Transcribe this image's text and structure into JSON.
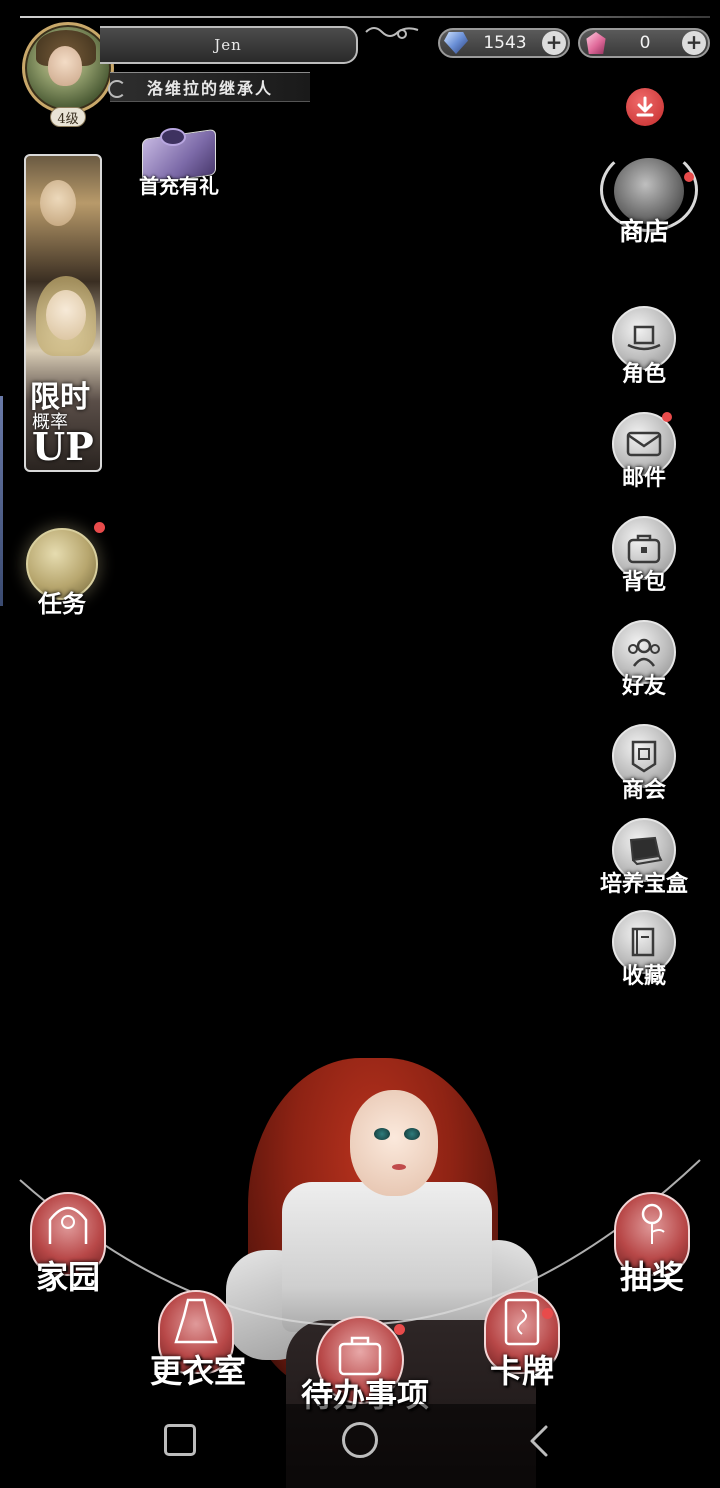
{
  "player": {
    "name": "Jen",
    "title": "洛维拉的继承人",
    "level": "4级"
  },
  "currency": [
    {
      "icon": "blue-crystal-icon",
      "value": "1543"
    },
    {
      "icon": "pink-crystal-icon",
      "value": "0"
    }
  ],
  "promo": {
    "first_recharge_label": "首充有礼",
    "limited_title": "限时",
    "limited_sub": "概率",
    "limited_up": "UP"
  },
  "quest": {
    "label": "任务"
  },
  "shop": {
    "label": "商店"
  },
  "side_menu": [
    {
      "label": "角色",
      "icon": "top-hat-icon",
      "notify": false
    },
    {
      "label": "邮件",
      "icon": "envelope-icon",
      "notify": true
    },
    {
      "label": "背包",
      "icon": "bag-icon",
      "notify": false
    },
    {
      "label": "好友",
      "icon": "friends-icon",
      "notify": false
    },
    {
      "label": "商会",
      "icon": "banner-icon",
      "notify": false
    },
    {
      "label": "培养宝盒",
      "icon": "treasure-box-icon",
      "notify": false
    },
    {
      "label": "收藏",
      "icon": "book-icon",
      "notify": false
    }
  ],
  "bottom_nav": {
    "home": "家园",
    "wardrobe": "更衣室",
    "todo": "待办事项",
    "cards": "卡牌",
    "gacha": "抽奖"
  },
  "colors": {
    "notify_dot": "#e84b4b",
    "nav_accent": "#b84848",
    "background": "#000000"
  }
}
